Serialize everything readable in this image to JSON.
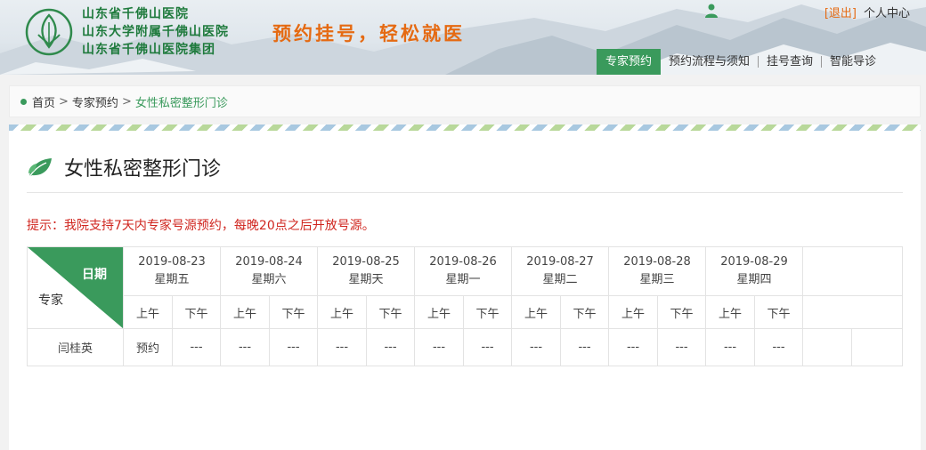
{
  "header": {
    "hospital_names": [
      "山东省千佛山医院",
      "山东大学附属千佛山医院",
      "山东省千佛山医院集团"
    ],
    "slogan": "预约挂号，轻松就医",
    "logout_label": "退出",
    "user_center_label": "个人中心",
    "nav": [
      {
        "label": "专家预约",
        "active": true
      },
      {
        "label": "预约流程与须知",
        "active": false
      },
      {
        "label": "挂号查询",
        "active": false
      },
      {
        "label": "智能导诊",
        "active": false
      }
    ]
  },
  "breadcrumb": {
    "home": "首页",
    "level1": "专家预约",
    "current": "女性私密整形门诊"
  },
  "page": {
    "title": "女性私密整形门诊",
    "tip": "提示：我院支持7天内专家号源预约，每晚20点之后开放号源。"
  },
  "schedule": {
    "corner_day_label": "日期",
    "corner_expert_label": "专家",
    "dates": [
      {
        "date": "2019-08-23",
        "weekday": "星期五"
      },
      {
        "date": "2019-08-24",
        "weekday": "星期六"
      },
      {
        "date": "2019-08-25",
        "weekday": "星期天"
      },
      {
        "date": "2019-08-26",
        "weekday": "星期一"
      },
      {
        "date": "2019-08-27",
        "weekday": "星期二"
      },
      {
        "date": "2019-08-28",
        "weekday": "星期三"
      },
      {
        "date": "2019-08-29",
        "weekday": "星期四"
      }
    ],
    "am_label": "上午",
    "pm_label": "下午",
    "rows": [
      {
        "expert": "闫桂英",
        "slots": [
          "预约",
          "---",
          "---",
          "---",
          "---",
          "---",
          "---",
          "---",
          "---",
          "---",
          "---",
          "---",
          "---",
          "---"
        ]
      }
    ]
  },
  "colors": {
    "brand_green": "#3a9a5c",
    "accent_orange": "#e56a12",
    "tip_red": "#d0261f"
  }
}
